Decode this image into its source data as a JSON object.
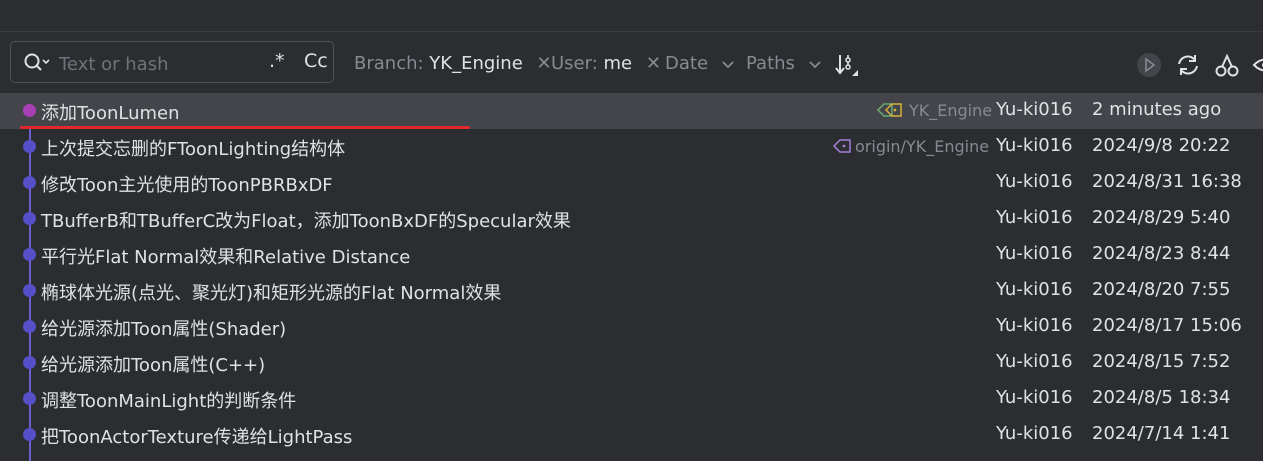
{
  "search": {
    "placeholder": "Text or hash",
    "regex_label": ".*",
    "case_label": "Cc"
  },
  "filters": {
    "branch": {
      "label": "Branch:",
      "value": "YK_Engine"
    },
    "user": {
      "label": "User:",
      "value": "me"
    },
    "date": {
      "label": "Date"
    },
    "paths": {
      "label": "Paths"
    }
  },
  "toolbar_icons": [
    "sort-icon",
    "run-icon",
    "refresh-icon",
    "cherry-pick-icon",
    "eye-icon"
  ],
  "commits": [
    {
      "message": "添加ToonLumen",
      "ref": "YK_Engine",
      "author": "Yu-ki016",
      "date": "2 minutes ago"
    },
    {
      "message": "上次提交忘删的FToonLighting结构体",
      "ref": "origin/YK_Engine",
      "author": "Yu-ki016",
      "date": "2024/9/8 20:22"
    },
    {
      "message": "修改Toon主光使用的ToonPBRBxDF",
      "author": "Yu-ki016",
      "date": "2024/8/31 16:38"
    },
    {
      "message": "TBufferB和TBufferC改为Float，添加ToonBxDF的Specular效果",
      "author": "Yu-ki016",
      "date": "2024/8/29 5:40"
    },
    {
      "message": "平行光Flat Normal效果和Relative Distance",
      "author": "Yu-ki016",
      "date": "2024/8/23 8:44"
    },
    {
      "message": "椭球体光源(点光、聚光灯)和矩形光源的Flat Normal效果",
      "author": "Yu-ki016",
      "date": "2024/8/20 7:55"
    },
    {
      "message": "给光源添加Toon属性(Shader)",
      "author": "Yu-ki016",
      "date": "2024/8/17 15:06"
    },
    {
      "message": "给光源添加Toon属性(C++)",
      "author": "Yu-ki016",
      "date": "2024/8/15 7:52"
    },
    {
      "message": "调整ToonMainLight的判断条件",
      "author": "Yu-ki016",
      "date": "2024/8/5 18:34"
    },
    {
      "message": "把ToonActorTexture传递给LightPass",
      "author": "Yu-ki016",
      "date": "2024/7/14 1:41"
    }
  ],
  "colors": {
    "head_dot": "#a93fb5",
    "commit_dot": "#5550c8",
    "selection": "#43454a",
    "annotation": "#e0282f",
    "tag_green": "#6aab73",
    "tag_yellow": "#d9b23b",
    "tag_purple": "#a67fd6"
  }
}
